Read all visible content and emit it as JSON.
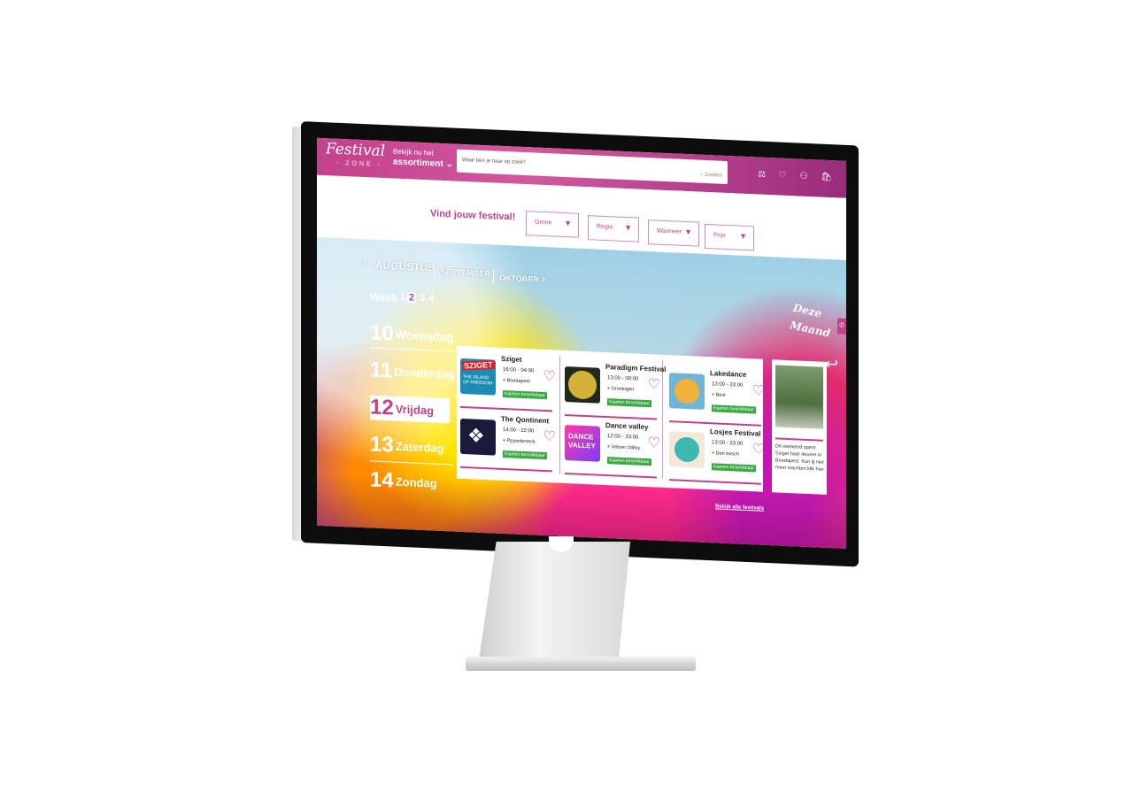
{
  "header": {
    "logo": "Festival",
    "logo_sub": "- ZONE -",
    "assort_line1": "Bekijk nu het",
    "assort_line2": "assortiment ⌄",
    "search_placeholder": "Waar ben je naar op zoek?",
    "search_button": "⌕ Zoeken",
    "icons": "⚖ ♡ ⚇ 🛍"
  },
  "filters": {
    "title": "Vind jouw festival!",
    "items": [
      {
        "label": "Genre",
        "caret": "▼"
      },
      {
        "label": "Regio",
        "caret": "▼"
      },
      {
        "label": "Wanneer",
        "caret": "▼"
      },
      {
        "label": "Prijs",
        "caret": "▼"
      }
    ]
  },
  "calendar": {
    "prev": "‹",
    "next": "›",
    "months": [
      "AUGUSTUS",
      "SEPTEMBER",
      "OKTOBER"
    ],
    "week_label": "Week",
    "weeks": [
      "1",
      "2",
      "3",
      "4"
    ],
    "active_week": "2",
    "days": [
      {
        "num": "10",
        "name": "Woensdag"
      },
      {
        "num": "11",
        "name": "Donderdag"
      },
      {
        "num": "12",
        "name": "Vrijdag"
      },
      {
        "num": "13",
        "name": "Zaterdag"
      },
      {
        "num": "14",
        "name": "Zondag"
      }
    ],
    "active_day": "12"
  },
  "festivals": [
    {
      "name": "Sziget",
      "time": "16:00 - 04:00",
      "location": "Boedapest",
      "tickets": "Kaarten beschikbaar",
      "logo_text": "SZIGET",
      "logo_sub": "THE ISLAND OF FREEDOM"
    },
    {
      "name": "The Qontinent",
      "time": "14:00 - 22:00",
      "location": "Ppyenbroeck",
      "tickets": "Kaarten beschikbaar",
      "logo_text": "❖"
    },
    {
      "name": "Paradigm Festival",
      "time": "13:00 - 00:00",
      "location": "Groningen",
      "tickets": "Kaarten beschikbaar"
    },
    {
      "name": "Dance valley",
      "time": "12:00 - 23:00",
      "location": "Velsen Valley",
      "tickets": "Kaarten beschikbaar",
      "logo_text": "DANCE VALLEY"
    },
    {
      "name": "Lakedance",
      "time": "13:00 - 23:00",
      "location": "Best",
      "tickets": "Kaarten beschikbaar"
    },
    {
      "name": "Losjes Festival",
      "time": "13:00 - 23:00",
      "location": "Den bosch",
      "tickets": "Kaarten beschikbaar"
    }
  ],
  "heart": "♡",
  "pin": "⌖",
  "deze_maand": {
    "line1": "Deze",
    "line2": "Maand",
    "arrow": "↩"
  },
  "news": {
    "text": "Dit weekend opent Sziget haar deuren in Boedapest. Kun jij niet meer wachten klik hier."
  },
  "all_link": "Bekijk alle festivals",
  "phone_icon": "✆"
}
